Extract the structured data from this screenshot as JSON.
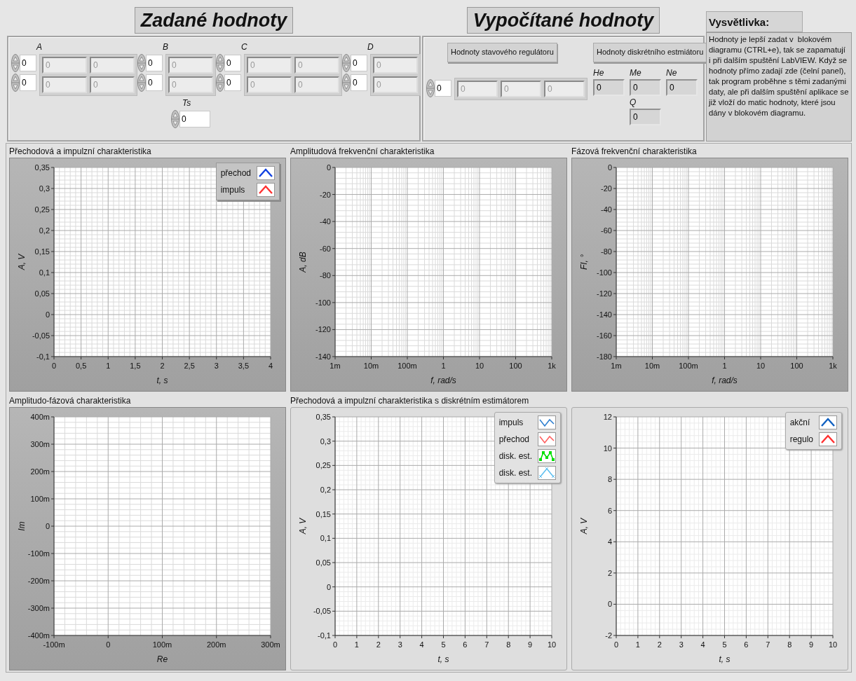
{
  "inputs": {
    "title": "Zadané hodnoty",
    "matrices": [
      {
        "label": "A",
        "indices": [
          "0",
          "0"
        ],
        "cells": [
          [
            "0",
            "0"
          ],
          [
            "0",
            "0"
          ]
        ]
      },
      {
        "label": "B",
        "indices": [
          "0",
          "0"
        ],
        "cells": [
          [
            "0"
          ],
          [
            "0"
          ]
        ]
      },
      {
        "label": "C",
        "indices": [
          "0",
          "0"
        ],
        "cells": [
          [
            "0",
            "0"
          ],
          [
            "0",
            "0"
          ]
        ]
      },
      {
        "label": "D",
        "indices": [
          "0",
          "0"
        ],
        "cells": [
          [
            "0"
          ],
          [
            "0"
          ]
        ]
      }
    ],
    "ts": {
      "label": "Ts",
      "value": "0"
    }
  },
  "outputs": {
    "title": "Vypočítané hodnoty",
    "regulator": {
      "heading": "Hodnoty stavového regulátoru",
      "index": "0",
      "cells": [
        "0",
        "0",
        "0"
      ]
    },
    "estimator": {
      "heading": "Hodnoty diskrétního estmiátoru",
      "fields": [
        {
          "label": "He",
          "value": "0"
        },
        {
          "label": "Me",
          "value": "0"
        },
        {
          "label": "Ne",
          "value": "0"
        },
        {
          "label": "Q",
          "value": "0"
        }
      ]
    }
  },
  "explanation": {
    "title": "Vysvětlivka:",
    "text": "Hodnoty je lepší zadat v  blokovém diagramu (CTRL+e), tak se zapamatují i při dalším spuštění LabVIEW. Když se hodnoty přímo zadají zde (čelní panel), tak program proběhne s těmi zadanými daty, ale při dalším spuštění aplikace se již vloží do matic hodnoty, které jsou dány v blokovém diagramu."
  },
  "charts": [
    {
      "kind": "dark",
      "legend": [
        {
          "label": "přechod",
          "color": "#1040e0",
          "kind": "peak"
        },
        {
          "label": "impuls",
          "color": "#ff3030",
          "kind": "peak"
        }
      ],
      "chart_data": {
        "type": "line",
        "title": "Přechodová a impulzní charakteristika",
        "xlabel": "t, s",
        "ylabel": "A, V",
        "grid": true,
        "xlim": [
          0,
          4
        ],
        "ylim": [
          -0.1,
          0.35
        ],
        "xticks": [
          0,
          {
            "value": 0.5,
            "label": "0,5"
          },
          1,
          {
            "value": 1.5,
            "label": "1,5"
          },
          2,
          {
            "value": 2.5,
            "label": "2,5"
          },
          3,
          {
            "value": 3.5,
            "label": "3,5"
          },
          4
        ],
        "yticks": [
          {
            "value": -0.1,
            "label": "-0,1"
          },
          {
            "value": -0.05,
            "label": "-0,05"
          },
          0,
          {
            "value": 0.05,
            "label": "0,05"
          },
          {
            "value": 0.1,
            "label": "0,1"
          },
          {
            "value": 0.15,
            "label": "0,15"
          },
          {
            "value": 0.2,
            "label": "0,2"
          },
          {
            "value": 0.25,
            "label": "0,25"
          },
          {
            "value": 0.3,
            "label": "0,3"
          },
          {
            "value": 0.35,
            "label": "0,35"
          }
        ]
      }
    },
    {
      "kind": "dark",
      "chart_data": {
        "type": "line",
        "title": "Amplitudová frekvenční charakteristika",
        "xlabel": "f, rad/s",
        "ylabel": "A, dB",
        "grid": true,
        "categories": [
          "1m",
          "10m",
          "100m",
          "1",
          "10",
          "100",
          "1k"
        ],
        "ylim": [
          -140,
          0
        ],
        "yticks": [
          -140,
          -120,
          -100,
          -80,
          -60,
          -40,
          -20,
          0
        ]
      }
    },
    {
      "kind": "dark",
      "chart_data": {
        "type": "line",
        "title": "Fázová frekvenční charakteristika",
        "xlabel": "f, rad/s",
        "ylabel": "FI, °",
        "grid": true,
        "categories": [
          "1m",
          "10m",
          "100m",
          "1",
          "10",
          "100",
          "1k"
        ],
        "ylim": [
          -180,
          0
        ],
        "yticks": [
          -180,
          -160,
          -140,
          -120,
          -100,
          -80,
          -60,
          -40,
          -20,
          0
        ]
      }
    },
    {
      "kind": "dark",
      "chart_data": {
        "type": "line",
        "title": "Amplitudo-fázová charakteristika",
        "xlabel": "Re",
        "ylabel": "Im",
        "grid": true,
        "xlim": [
          -100,
          300
        ],
        "ylim": [
          -400,
          400
        ],
        "xticks": [
          {
            "value": -100,
            "label": "-100m"
          },
          0,
          {
            "value": 100,
            "label": "100m"
          },
          {
            "value": 200,
            "label": "200m"
          },
          {
            "value": 300,
            "label": "300m"
          }
        ],
        "yticks": [
          {
            "value": -400,
            "label": "-400m"
          },
          {
            "value": -300,
            "label": "-300m"
          },
          {
            "value": -200,
            "label": "-200m"
          },
          {
            "value": -100,
            "label": "-100m"
          },
          0,
          {
            "value": 100,
            "label": "100m"
          },
          {
            "value": 200,
            "label": "200m"
          },
          {
            "value": 300,
            "label": "300m"
          },
          {
            "value": 400,
            "label": "400m"
          }
        ]
      }
    },
    {
      "kind": "light",
      "legend": [
        {
          "label": "impuls",
          "color": "#3080d0",
          "kind": "zigzag"
        },
        {
          "label": "přechod",
          "color": "#ff6060",
          "kind": "zigzag"
        },
        {
          "label": "disk. est.",
          "color": "#00e000",
          "kind": "markers"
        },
        {
          "label": "disk. est.",
          "color": "#60c0f0",
          "kind": "crosses"
        }
      ],
      "chart_data": {
        "type": "line",
        "title": "Přechodová a impulzní charakteristika s diskrétním estimátorem",
        "xlabel": "t, s",
        "ylabel": "A, V",
        "grid": true,
        "xlim": [
          0,
          10
        ],
        "ylim": [
          -0.1,
          0.35
        ],
        "xticks": [
          0,
          1,
          2,
          3,
          4,
          5,
          6,
          7,
          8,
          9,
          10
        ],
        "yticks": [
          {
            "value": -0.1,
            "label": "-0,1"
          },
          {
            "value": -0.05,
            "label": "-0,05"
          },
          0,
          {
            "value": 0.05,
            "label": "0,05"
          },
          {
            "value": 0.1,
            "label": "0,1"
          },
          {
            "value": 0.15,
            "label": "0,15"
          },
          {
            "value": 0.2,
            "label": "0,2"
          },
          {
            "value": 0.25,
            "label": "0,25"
          },
          {
            "value": 0.3,
            "label": "0,3"
          },
          {
            "value": 0.35,
            "label": "0,35"
          }
        ]
      }
    },
    {
      "kind": "light",
      "legend": [
        {
          "label": "akční",
          "color": "#1060c0",
          "kind": "peak"
        },
        {
          "label": "regulo",
          "color": "#ff3030",
          "kind": "peak"
        }
      ],
      "chart_data": {
        "type": "line",
        "xlabel": "t, s",
        "ylabel": "A, V",
        "grid": true,
        "xlim": [
          0,
          10
        ],
        "ylim": [
          -2,
          12
        ],
        "xticks": [
          0,
          1,
          2,
          3,
          4,
          5,
          6,
          7,
          8,
          9,
          10
        ],
        "yticks": [
          -2,
          0,
          2,
          4,
          6,
          8,
          10,
          12
        ]
      }
    }
  ]
}
